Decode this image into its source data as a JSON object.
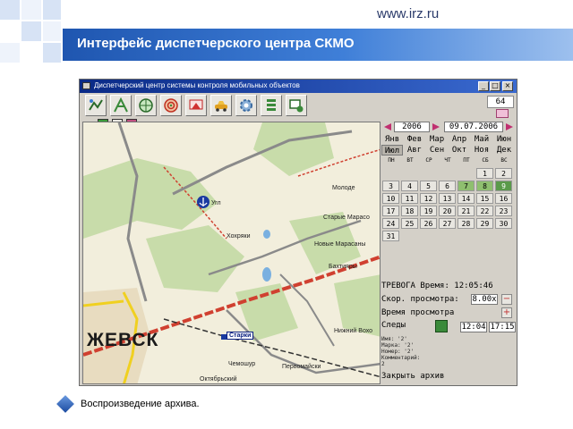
{
  "slide": {
    "url": "www.irz.ru",
    "title": "Интерфейс диспетчерского центра СКМО",
    "caption": "Воспроизведение архива."
  },
  "window": {
    "title": "Диспетчерский центр системы контроля мобильных объектов",
    "counter": "64"
  },
  "map": {
    "city": "ЖЕВСК",
    "marker_label": "Старки",
    "labels": [
      "Молоде",
      "Старые Марасо",
      "Хохряки",
      "Новые Марасаны",
      "Бахтияры",
      "Нижний Вохо",
      "Первомайски",
      "Чемошур",
      "Октябрьский",
      "Угл"
    ]
  },
  "calendar": {
    "year": "2006",
    "date": "09.07.2006",
    "months_row1": [
      "Янв",
      "Фев",
      "Мар",
      "Апр",
      "Май",
      "Июн"
    ],
    "months_row2": [
      "Июл",
      "Авг",
      "Сен",
      "Окт",
      "Ноя",
      "Дек"
    ],
    "selected_month": "Июл",
    "weekdays": [
      "ПН",
      "ВТ",
      "СР",
      "ЧТ",
      "ПТ",
      "СБ",
      "ВС"
    ],
    "weeks": [
      [
        "",
        "",
        "",
        "",
        "",
        "1",
        "2"
      ],
      [
        "3",
        "4",
        "5",
        "6",
        "7",
        "8",
        "9"
      ],
      [
        "10",
        "11",
        "12",
        "13",
        "14",
        "15",
        "16"
      ],
      [
        "17",
        "18",
        "19",
        "20",
        "21",
        "22",
        "23"
      ],
      [
        "24",
        "25",
        "26",
        "27",
        "28",
        "29",
        "30"
      ],
      [
        "31",
        "",
        "",
        "",
        "",
        "",
        ""
      ]
    ],
    "highlighted_days": [
      "7",
      "8"
    ],
    "selected_day": "9"
  },
  "panel": {
    "alarm_label": "ТРЕВОГА Время:",
    "alarm_time": "12:05:46",
    "speed_label": "Скор. просмотра:",
    "speed_value": "8.00x",
    "view_time_label": "Время просмотра",
    "traces_label": "Следы",
    "time_from": "12:04",
    "time_to": "17:15",
    "info": [
      "Имя: '2'",
      "Марка: '2'",
      "Номер: '2'",
      "Комментарий:",
      "2"
    ],
    "close_archive": "Закрыть архив"
  },
  "colors": {
    "title_bar": "#1f56b0",
    "window_title": "#0a2a86",
    "map_road_red": "#d04030",
    "map_road_yellow": "#f0d020",
    "forest": "#c8dcaa",
    "day_highlight": "#8fbf6f"
  },
  "icons": [
    "window-app-icon",
    "minimize-icon",
    "maximize-icon",
    "close-icon",
    "map-tools-icon",
    "routes-icon",
    "globe-icon",
    "target-icon",
    "sos-icon",
    "car-icon",
    "settings-icon",
    "list-icon",
    "monitor-icon",
    "pause-icon",
    "record-icon",
    "mail-icon",
    "anchor-marker-icon",
    "check-icon",
    "diamond-bullet-icon"
  ]
}
